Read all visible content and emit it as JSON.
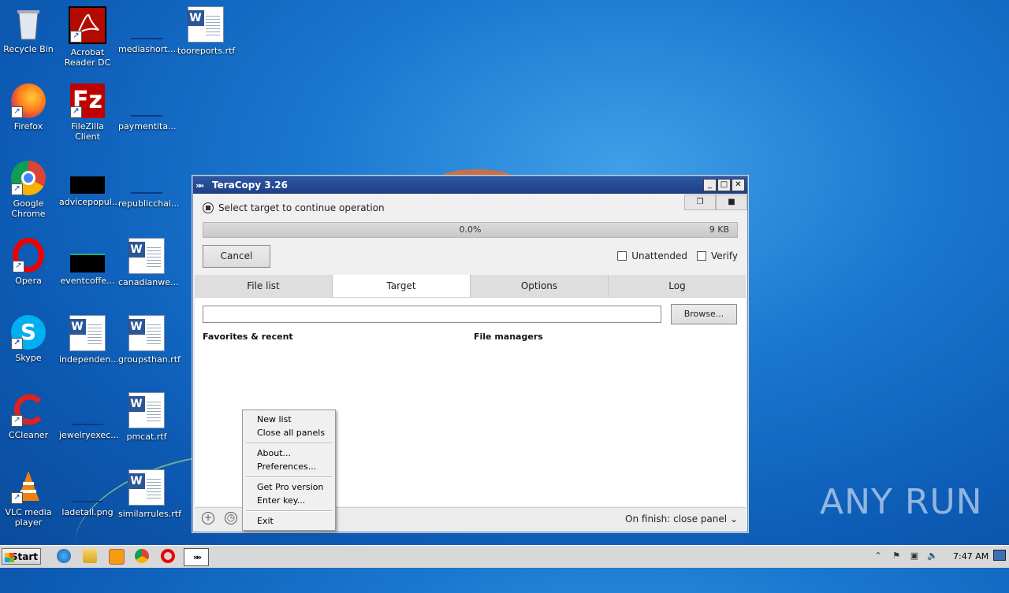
{
  "desktop": {
    "icons": [
      {
        "label": "Recycle Bin"
      },
      {
        "label": "Acrobat Reader DC"
      },
      {
        "label": "mediashort...."
      },
      {
        "label": "tooreports.rtf"
      },
      {
        "label": "Firefox"
      },
      {
        "label": "FileZilla Client"
      },
      {
        "label": "paymentita..."
      },
      {
        "label": "Google Chrome"
      },
      {
        "label": "advicepopul..."
      },
      {
        "label": "republicchai..."
      },
      {
        "label": "Opera"
      },
      {
        "label": "eventcoffe..."
      },
      {
        "label": "canadianwe..."
      },
      {
        "label": "Skype"
      },
      {
        "label": "independen..."
      },
      {
        "label": "groupsthan.rtf"
      },
      {
        "label": "CCleaner"
      },
      {
        "label": "jewelryexec..."
      },
      {
        "label": "pmcat.rtf"
      },
      {
        "label": "VLC media player"
      },
      {
        "label": "ladetail.png"
      },
      {
        "label": "similarrules.rtf"
      }
    ]
  },
  "window": {
    "title": "TeraCopy 3.26",
    "status": "Select target to continue operation",
    "progress": {
      "percent_label": "0.0%",
      "size_label": "9 KB",
      "value": 0.0
    },
    "cancel_label": "Cancel",
    "unattended_label": "Unattended",
    "verify_label": "Verify",
    "tabs": [
      "File list",
      "Target",
      "Options",
      "Log"
    ],
    "browse_label": "Browse...",
    "favorites_label": "Favorites & recent",
    "file_managers_label": "File managers",
    "on_finish_label": "On finish: close panel"
  },
  "context_menu": {
    "items": [
      "New list",
      "Close all panels",
      "About...",
      "Preferences...",
      "Get Pro version",
      "Enter key...",
      "Exit"
    ]
  },
  "taskbar": {
    "start_label": "Start",
    "clock": "7:47 AM"
  },
  "watermark": "ANY RUN"
}
